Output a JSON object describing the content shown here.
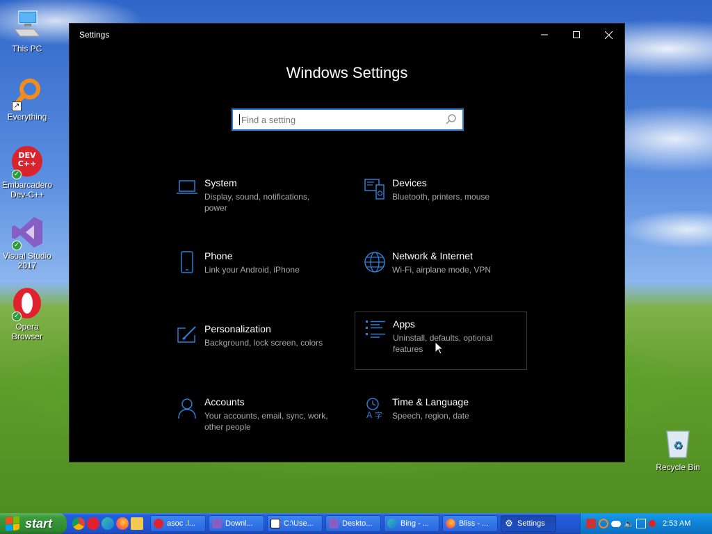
{
  "desktop": {
    "icons": [
      {
        "label": "This PC"
      },
      {
        "label": "Everything"
      },
      {
        "label": "Embarcadero Dev-C++",
        "badge": "DEV C++"
      },
      {
        "label": "Visual Studio 2017"
      },
      {
        "label": "Opera Browser"
      },
      {
        "label": "Recycle Bin"
      }
    ]
  },
  "window": {
    "title": "Settings",
    "heading": "Windows Settings",
    "search": {
      "placeholder": "Find a setting",
      "value": ""
    },
    "controls": {
      "minimize": "—",
      "maximize": "☐",
      "close": "✕"
    },
    "accent": "#2b7fd6",
    "tiles": [
      {
        "name": "System",
        "desc": "Display, sound, notifications, power",
        "icon": "laptop-icon"
      },
      {
        "name": "Devices",
        "desc": "Bluetooth, printers, mouse",
        "icon": "devices-icon"
      },
      {
        "name": "Phone",
        "desc": "Link your Android, iPhone",
        "icon": "phone-icon"
      },
      {
        "name": "Network & Internet",
        "desc": "Wi-Fi, airplane mode, VPN",
        "icon": "globe-icon"
      },
      {
        "name": "Personalization",
        "desc": "Background, lock screen, colors",
        "icon": "paint-icon"
      },
      {
        "name": "Apps",
        "desc": "Uninstall, defaults, optional features",
        "icon": "apps-list-icon"
      },
      {
        "name": "Accounts",
        "desc": "Your accounts, email, sync, work, other people",
        "icon": "person-icon"
      },
      {
        "name": "Time & Language",
        "desc": "Speech, region, date",
        "icon": "time-language-icon"
      }
    ]
  },
  "taskbar": {
    "start_label": "start",
    "tasks": [
      {
        "label": "asoc .l..."
      },
      {
        "label": "Downl..."
      },
      {
        "label": "C:\\Use..."
      },
      {
        "label": "Deskto..."
      },
      {
        "label": "Bing - ..."
      },
      {
        "label": "Bliss - ..."
      },
      {
        "label": "Settings"
      }
    ],
    "clock": "2:53 AM"
  }
}
